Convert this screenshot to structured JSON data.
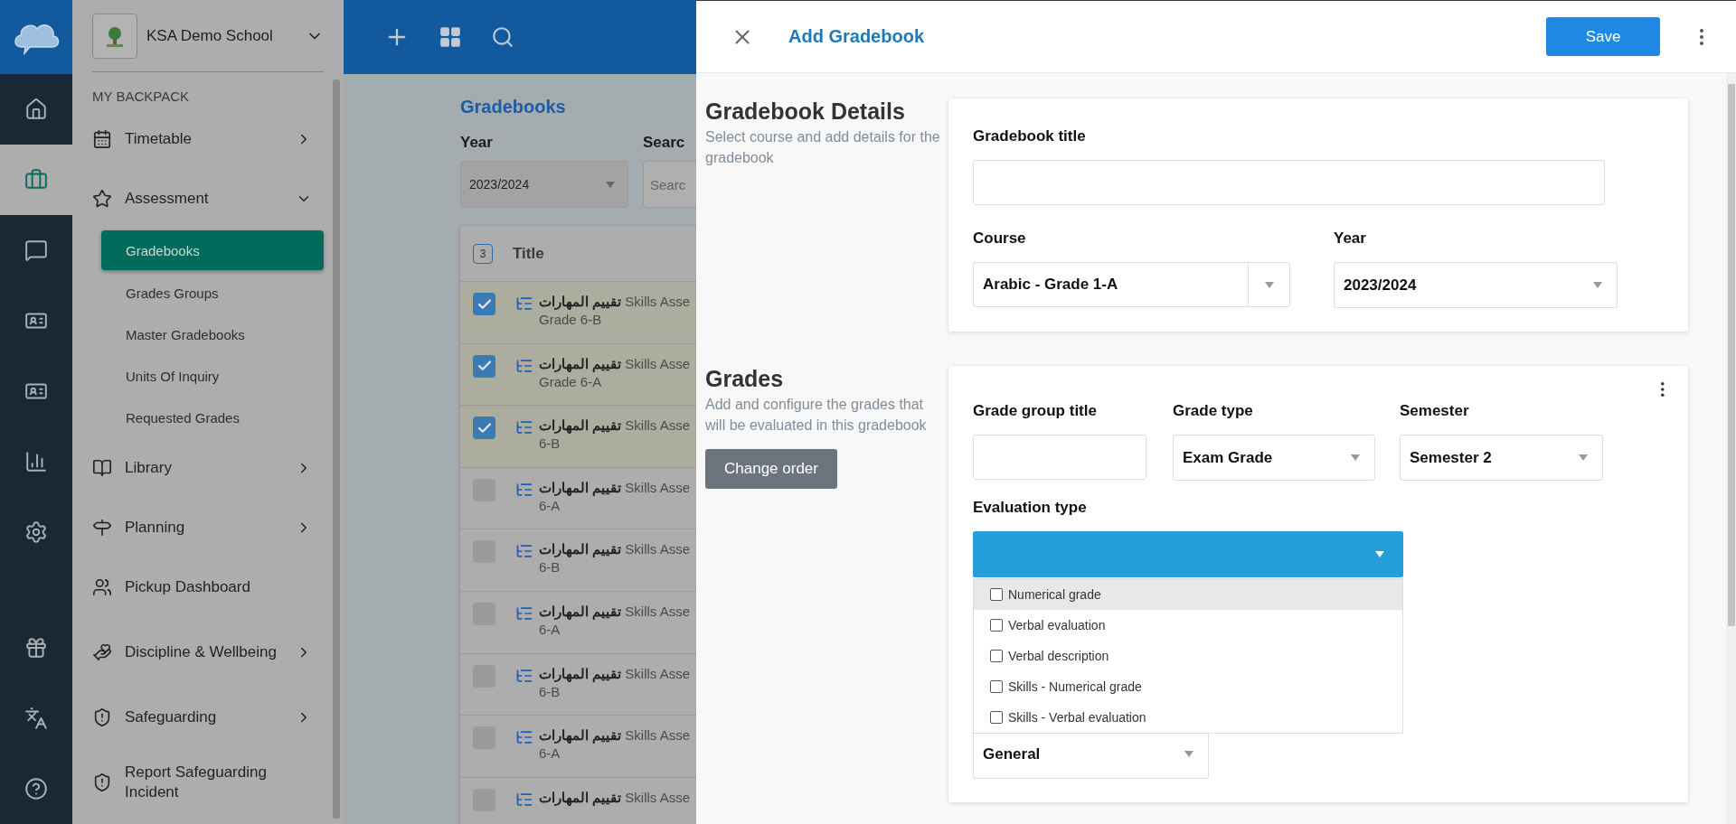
{
  "rail": {
    "items": [
      {
        "selected": false
      },
      {
        "selected": true
      },
      {
        "selected": false
      },
      {
        "selected": false
      },
      {
        "selected": false
      },
      {
        "selected": false
      },
      {
        "selected": false
      },
      {
        "selected": false
      },
      {
        "selected": false
      },
      {
        "selected": false
      }
    ]
  },
  "school": {
    "name": "KSA Demo School"
  },
  "sidebar": {
    "section": "MY BACKPACK",
    "items": [
      {
        "kind": "group",
        "label": "Timetable",
        "expanded": false
      },
      {
        "kind": "group",
        "label": "Assessment",
        "expanded": true,
        "children": [
          {
            "label": "Gradebooks",
            "selected": true
          },
          {
            "label": "Grades Groups",
            "selected": false
          },
          {
            "label": "Master Gradebooks",
            "selected": false
          },
          {
            "label": "Units Of Inquiry",
            "selected": false
          },
          {
            "label": "Requested Grades",
            "selected": false
          }
        ]
      },
      {
        "kind": "group",
        "label": "Library",
        "expanded": false
      },
      {
        "kind": "group",
        "label": "Planning",
        "expanded": false
      },
      {
        "kind": "link",
        "label": "Pickup Dashboard"
      },
      {
        "kind": "group",
        "label": "Discipline & Wellbeing",
        "expanded": false
      },
      {
        "kind": "group",
        "label": "Safeguarding",
        "expanded": false
      },
      {
        "kind": "link",
        "label": "Report Safeguarding Incident"
      }
    ]
  },
  "page": {
    "title": "Gradebooks",
    "year_label": "Year",
    "year_value": "2023/2024",
    "search_label": "Searc",
    "search_placeholder": "Searc"
  },
  "table": {
    "selected_count": "3",
    "columns": [
      "Title"
    ],
    "rows": [
      {
        "title": "**تقييم المهارات** Skills Asse",
        "line2": "Grade 6-B",
        "selected": true
      },
      {
        "title": "**تقييم المهارات** Skills Asse",
        "line2": "Grade 6-A",
        "selected": true
      },
      {
        "title": "**تقييم المهارات** Skills Asse",
        "line2": "6-B",
        "selected": true
      },
      {
        "title": "**تقييم المهارات** Skills Asse",
        "line2": "6-A",
        "selected": false
      },
      {
        "title": "**تقييم المهارات** Skills Asse",
        "line2": "6-B",
        "selected": false
      },
      {
        "title": "**تقييم المهارات** Skills Asse",
        "line2": "6-A",
        "selected": false
      },
      {
        "title": "**تقييم المهارات** Skills Asse",
        "line2": "6-B",
        "selected": false
      },
      {
        "title": "**تقييم المهارات** Skills Asse",
        "line2": "6-A",
        "selected": false
      },
      {
        "title": "**تقييم المهارات** Skills Asse",
        "selected": false
      }
    ]
  },
  "panel": {
    "title": "Add Gradebook",
    "save": "Save",
    "details": {
      "heading": "Gradebook Details",
      "description": "Select course and add details for the gradebook",
      "title_label": "Gradebook title",
      "course_label": "Course",
      "course_value": "Arabic - Grade 1-A",
      "year_label": "Year",
      "year_value": "2023/2024"
    },
    "grades": {
      "heading": "Grades",
      "description": "Add and configure the grades that will be evaluated in this gradebook",
      "change_order": "Change order",
      "group_title_label": "Grade group title",
      "grade_type_label": "Grade type",
      "grade_type_value": "Exam Grade",
      "semester_label": "Semester",
      "semester_value": "Semester 2",
      "evaluation_label": "Evaluation type",
      "evaluation_open": true,
      "evaluation_options": [
        {
          "label": "Numerical grade",
          "checked": false,
          "selected": true
        },
        {
          "label": "Verbal evaluation",
          "checked": false,
          "selected": false
        },
        {
          "label": "Verbal description",
          "checked": false,
          "selected": false
        },
        {
          "label": "Skills - Numerical grade",
          "checked": false,
          "selected": false
        },
        {
          "label": "Skills - Verbal evaluation",
          "checked": false,
          "selected": false
        }
      ],
      "category_value": "General"
    }
  }
}
